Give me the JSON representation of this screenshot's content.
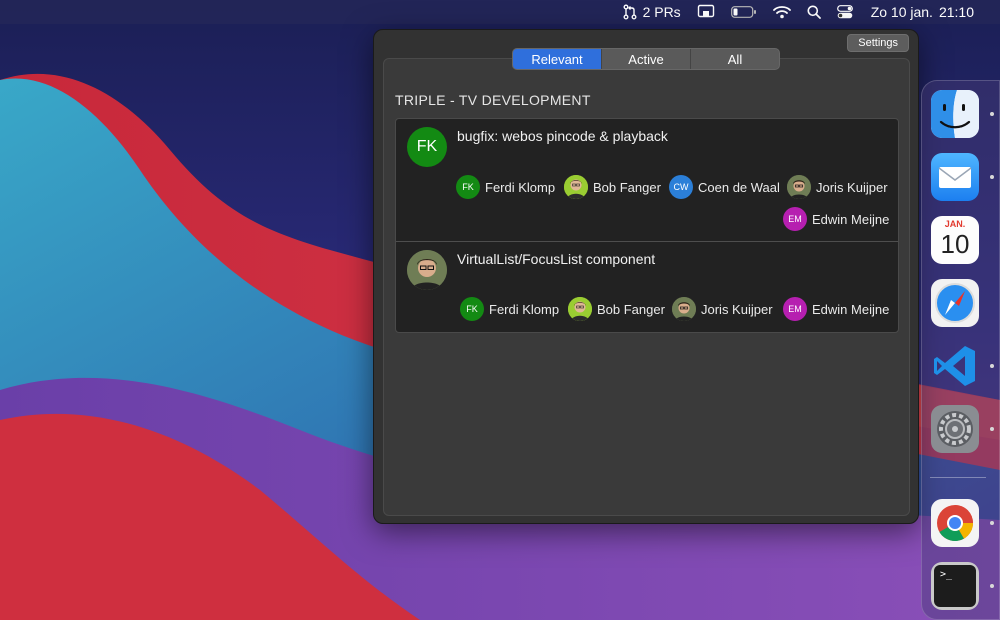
{
  "menubar": {
    "pr_count": "2 PRs",
    "day": "Zo 10 jan.",
    "time": "21:10",
    "icons": [
      "pull-request-icon",
      "screen-share-icon",
      "battery-icon",
      "wifi-icon",
      "search-icon",
      "control-center-icon"
    ]
  },
  "popover": {
    "settings_label": "Settings",
    "tabs": [
      {
        "label": "Relevant",
        "active": true
      },
      {
        "label": "Active",
        "active": false
      },
      {
        "label": "All",
        "active": false
      }
    ],
    "group_title": "TRIPLE - TV DEVELOPMENT",
    "prs": [
      {
        "title": "bugfix: webos pincode & playback",
        "author_initials": "FK",
        "author_color": "#138a13",
        "reviewers": [
          {
            "name": "Ferdi Klomp",
            "initials": "FK",
            "color": "#138a13"
          },
          {
            "name": "Bob Fanger",
            "initials": "",
            "color": "#9acd32"
          },
          {
            "name": "Coen de Waal",
            "initials": "CW",
            "color": "#2b7fd8"
          },
          {
            "name": "Joris Kuijper",
            "initials": "",
            "color": "#5c6b4a"
          },
          {
            "name": "Edwin Meijne",
            "initials": "EM",
            "color": "#b61fb0"
          }
        ]
      },
      {
        "title": "VirtualList/FocusList component",
        "author_initials": "",
        "author_color": "#5c6b4a",
        "reviewers": [
          {
            "name": "Ferdi Klomp",
            "initials": "FK",
            "color": "#138a13"
          },
          {
            "name": "Bob Fanger",
            "initials": "",
            "color": "#9acd32"
          },
          {
            "name": "Joris Kuijper",
            "initials": "",
            "color": "#5c6b4a"
          },
          {
            "name": "Edwin Meijne",
            "initials": "EM",
            "color": "#b61fb0"
          }
        ]
      }
    ]
  },
  "dock": {
    "apps": [
      "finder",
      "mail",
      "calendar",
      "safari",
      "vscode",
      "system-preferences",
      "chrome",
      "terminal"
    ],
    "calendar_month": "JAN.",
    "calendar_day": "10",
    "terminal_prompt": ">_"
  }
}
